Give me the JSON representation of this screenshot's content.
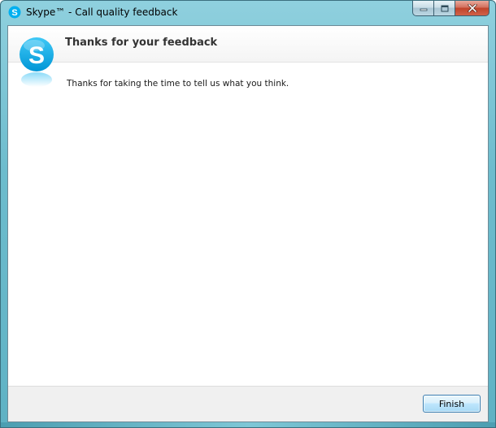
{
  "window": {
    "title": "Skype™ - Call quality feedback"
  },
  "header": {
    "title": "Thanks for your feedback"
  },
  "body": {
    "message": "Thanks for taking the time to tell us what you think."
  },
  "footer": {
    "finish_label": "Finish"
  },
  "icons": {
    "app": "skype-icon",
    "logo": "skype-logo-icon",
    "minimize": "minimize-icon",
    "maximize": "maximize-icon",
    "close": "close-icon"
  },
  "colors": {
    "skype_blue": "#00aff0",
    "window_frame": "#6dbccd",
    "close_red": "#c0432a"
  }
}
